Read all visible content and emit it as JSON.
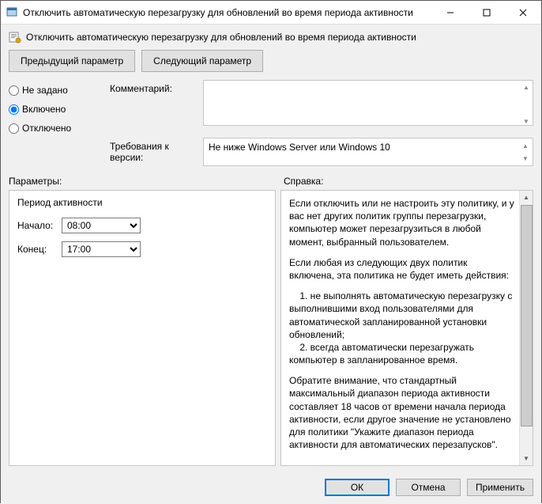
{
  "window": {
    "title": "Отключить автоматическую перезагрузку для обновлений во время периода активности"
  },
  "header": {
    "title": "Отключить автоматическую перезагрузку для обновлений во время периода активности"
  },
  "nav": {
    "prev": "Предыдущий параметр",
    "next": "Следующий параметр"
  },
  "state": {
    "not_configured": "Не задано",
    "enabled": "Включено",
    "disabled": "Отключено",
    "selected": "enabled"
  },
  "fields": {
    "comment_label": "Комментарий:",
    "comment_value": "",
    "supported_label": "Требования к версии:",
    "supported_value": "Не ниже Windows Server или Windows 10"
  },
  "labels": {
    "parameters": "Параметры:",
    "help": "Справка:"
  },
  "options": {
    "group_title": "Период активности",
    "start_label": "Начало:",
    "start_value": "08:00",
    "end_label": "Конец:",
    "end_value": "17:00"
  },
  "help": {
    "p1": "Если отключить или не настроить эту политику, и у вас нет других политик группы перезагрузки, компьютер может перезагрузиться в любой момент, выбранный пользователем.",
    "p2": "Если любая из следующих двух политик включена, эта политика не будет иметь действия:",
    "li1": "    1. не выполнять автоматическую перезагрузку с выполнившими вход пользователями для автоматической запланированной установки обновлений;",
    "li2": "    2. всегда автоматически перезагружать компьютер в запланированное время.",
    "p3": "Обратите внимание, что стандартный максимальный диапазон периода активности составляет 18 часов от времени начала периода активности, если другое значение не установлено для политики \"Укажите диапазон периода активности для автоматических перезапусков\"."
  },
  "footer": {
    "ok": "ОК",
    "cancel": "Отмена",
    "apply": "Применить"
  }
}
